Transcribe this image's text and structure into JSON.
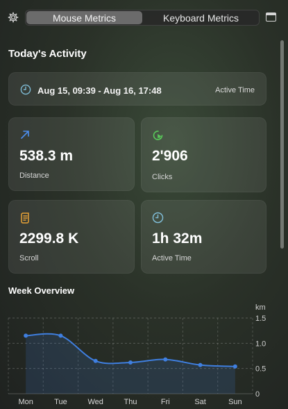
{
  "tabs": [
    {
      "label": "Mouse Metrics",
      "active": true
    },
    {
      "label": "Keyboard Metrics",
      "active": false
    }
  ],
  "today": {
    "title": "Today's Activity",
    "range": "Aug 15, 09:39 - Aug 16, 17:48",
    "range_label": "Active Time"
  },
  "metrics": {
    "distance": {
      "value": "538.3 m",
      "label": "Distance"
    },
    "clicks": {
      "value": "2'906",
      "label": "Clicks"
    },
    "scroll": {
      "value": "2299.8 K",
      "label": "Scroll"
    },
    "active_time": {
      "value": "1h 32m",
      "label": "Active Time"
    }
  },
  "week": {
    "title": "Week Overview"
  },
  "colors": {
    "accent_blue": "#3f7fe0",
    "arrow_blue": "#4d8ef0",
    "click_green": "#59c95a",
    "scroll_orange": "#e7a237",
    "clock_teal": "#7fbcd6"
  },
  "chart_data": {
    "type": "area",
    "categories": [
      "Mon",
      "Tue",
      "Wed",
      "Thu",
      "Fri",
      "Sat",
      "Sun"
    ],
    "series": [
      {
        "values": [
          1.15,
          1.15,
          0.65,
          0.62,
          0.68,
          0.57,
          0.54
        ]
      }
    ],
    "ylabel": "km",
    "yticks": [
      "0",
      "0.5",
      "1.0",
      "1.5"
    ],
    "ylim": [
      0,
      1.5
    ],
    "grid": true,
    "y_axis_side": "right"
  }
}
